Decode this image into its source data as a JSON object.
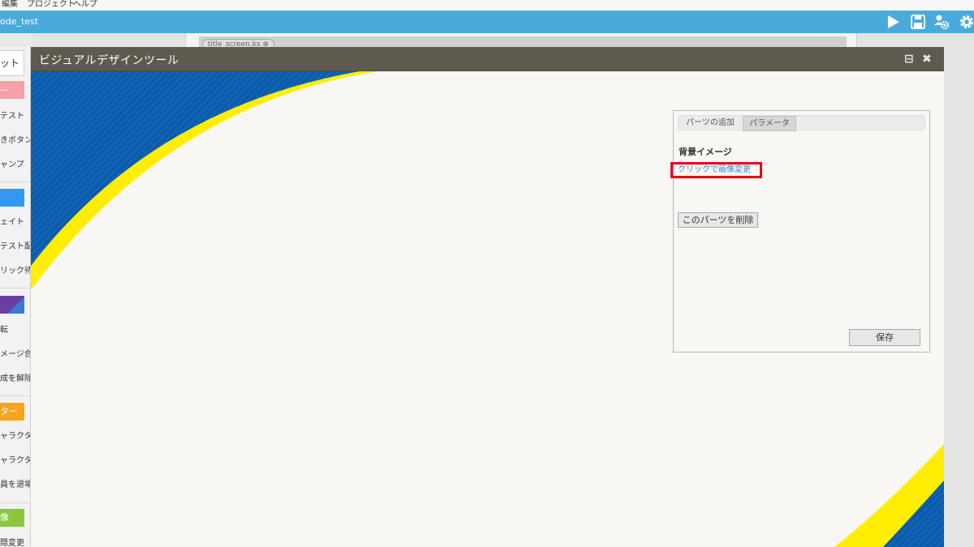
{
  "menubar": {
    "items": [
      "編集",
      "プロジェクト",
      "ヘルプ"
    ]
  },
  "appbar": {
    "project_name": "ode_test",
    "icons": [
      "play-icon",
      "save-icon",
      "users-gear-icon",
      "gear-icon"
    ],
    "color": "#4aaadb"
  },
  "editor": {
    "file_tab": "title_screen.ks"
  },
  "left_panel": {
    "tab_label": "ット",
    "categories": [
      {
        "label": "—",
        "color": "#f5a0a8",
        "items": [
          "テスト",
          "きボタン",
          "ャンプ"
        ]
      },
      {
        "label": "",
        "color": "#3399f0",
        "items": [
          "ェイト",
          "テスト配置",
          "リック待ち"
        ]
      },
      {
        "label": "",
        "color": "#6b3fa0",
        "items": [
          "転",
          "メージ合成",
          "成を解除"
        ]
      },
      {
        "label": "ター",
        "color": "#f4a61c",
        "items": [
          "ャラクター",
          "ャラクター",
          "員を退場"
        ]
      },
      {
        "label": "像",
        "color": "#8cc63e",
        "items": [
          "隠変更"
        ]
      }
    ]
  },
  "modal": {
    "title": "ビジュアルデザインツール",
    "colors": {
      "blue": "#0e63b5",
      "yellow": "#ffee00",
      "header": "#5f5a50"
    }
  },
  "panel": {
    "tabs": [
      "パーツの追加",
      "パラメータ"
    ],
    "active_tab": "パラメータ",
    "section_label": "背景イメージ",
    "change_link": "クリックで画像変更",
    "delete_button": "このパーツを削除",
    "save_button": "保存"
  }
}
